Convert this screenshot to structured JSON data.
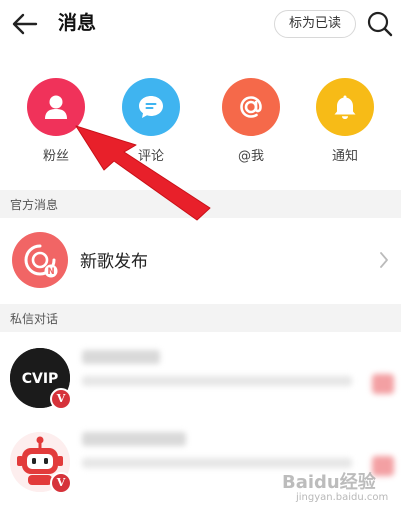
{
  "header": {
    "title": "消息",
    "mark_read_label": "标为已读",
    "back_icon": "arrow-left-icon",
    "search_icon": "search-icon"
  },
  "quick_actions": [
    {
      "label": "粉丝",
      "icon": "person-icon",
      "color": "#f0325a"
    },
    {
      "label": "评论",
      "icon": "chat-bubble-icon",
      "color": "#3fb4f0"
    },
    {
      "label": "@我",
      "icon": "at-sign-icon",
      "color": "#f5694a"
    },
    {
      "label": "通知",
      "icon": "bell-icon",
      "color": "#f7bb17"
    }
  ],
  "sections": {
    "official": "官方消息",
    "private": "私信对话"
  },
  "official_item": {
    "name": "新歌发布",
    "icon": "vinyl-disc-icon",
    "color": "#f16565"
  },
  "private_items": [
    {
      "avatar": "cvip-logo",
      "avatar_text": "CVIP",
      "badge": "V"
    },
    {
      "avatar": "robot-mascot-icon",
      "badge": "V"
    }
  ],
  "annotation": {
    "arrow_color": "#e8202a"
  },
  "watermark": {
    "text": "Baidu经验",
    "sub": "jingyan.baidu.com"
  }
}
